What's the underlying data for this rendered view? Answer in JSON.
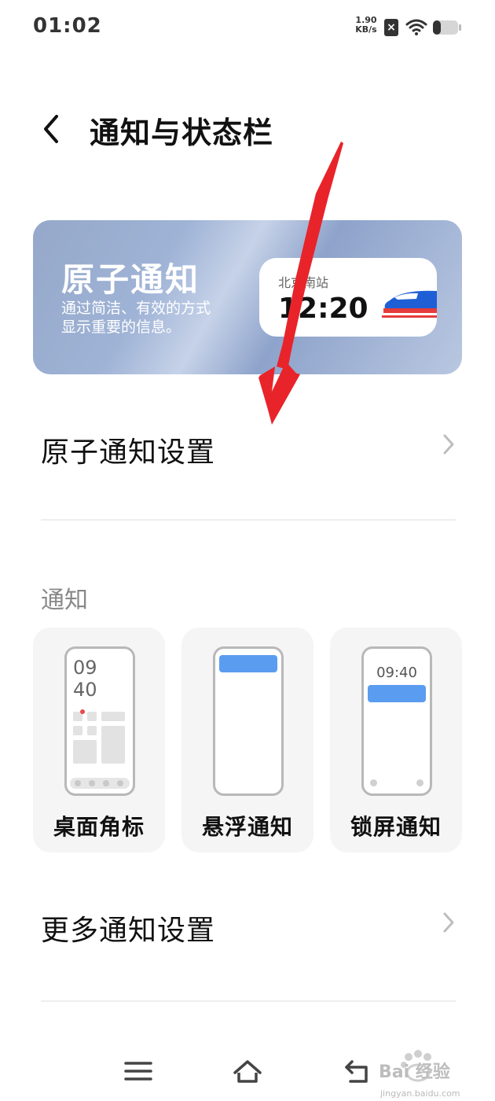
{
  "status_bar": {
    "time": "01:02",
    "net_speed_value": "1.90",
    "net_speed_unit": "KB/s",
    "sim_icon": "no-sim-icon",
    "wifi_icon": "wifi-icon",
    "battery_icon": "battery-icon"
  },
  "header": {
    "back_icon": "chevron-left-icon",
    "title": "通知与状态栏"
  },
  "banner": {
    "title": "原子通知",
    "desc_line1": "通过简洁、有效的方式",
    "desc_line2": "显示重要的信息。",
    "pill_station": "北京南站",
    "pill_time": "12:20",
    "pill_icon": "train-icon"
  },
  "rows": {
    "atomic_settings": "原子通知设置",
    "more_settings": "更多通知设置"
  },
  "section": {
    "title": "通知"
  },
  "cards": [
    {
      "label": "桌面角标",
      "preview_clock_line1": "09",
      "preview_clock_line2": "40"
    },
    {
      "label": "悬浮通知"
    },
    {
      "label": "锁屏通知",
      "preview_clock": "09:40"
    }
  ],
  "colors": {
    "accent_blue": "#5a9cf0",
    "badge_red": "#e84a4a",
    "annotation_red": "#e8242a"
  },
  "nav": {
    "menu_icon": "menu-icon",
    "home_icon": "home-icon",
    "back_icon": "back-icon"
  },
  "watermark": {
    "logo_text": "Bai 经验",
    "url": "jingyan.baidu.com"
  }
}
